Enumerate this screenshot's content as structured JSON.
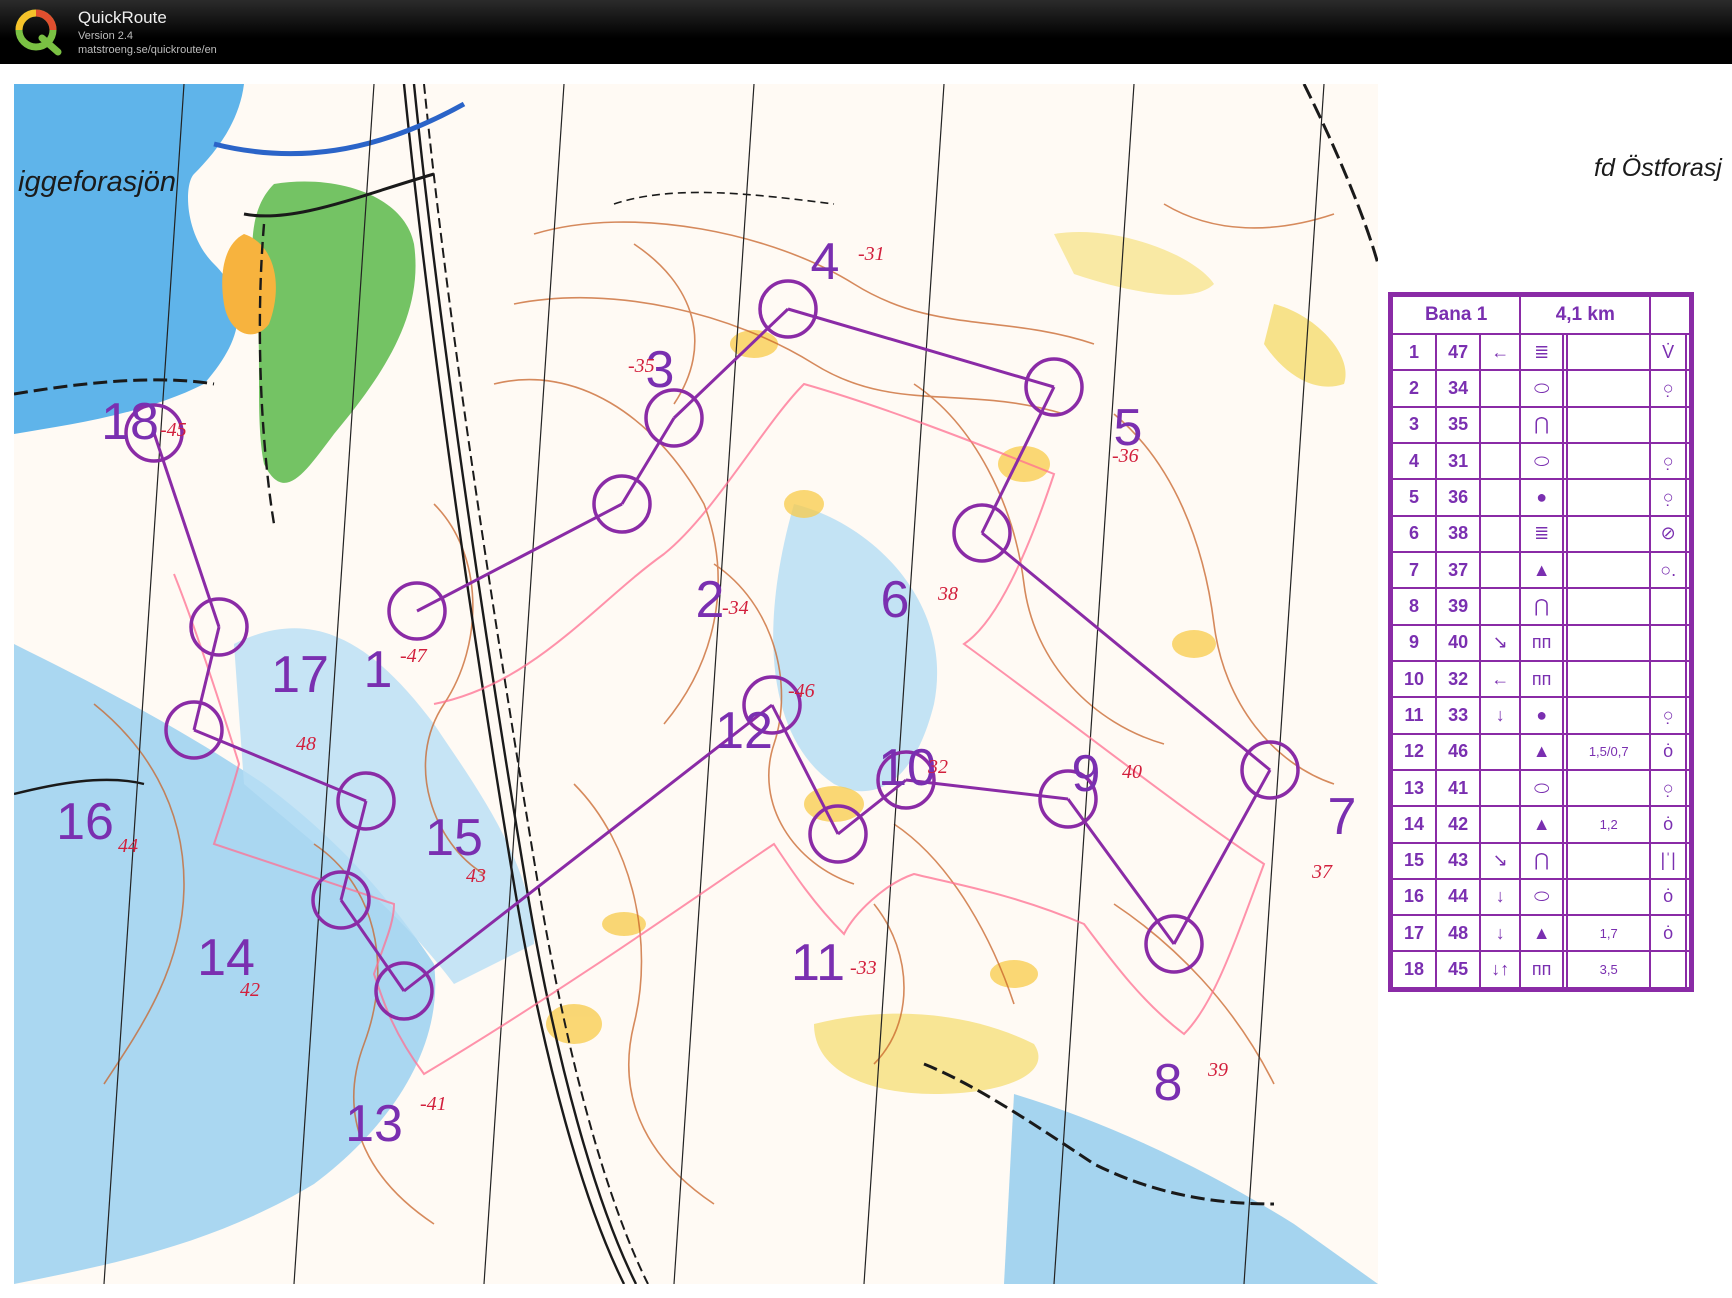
{
  "app": {
    "name": "QuickRoute",
    "version": "Version 2.4",
    "url": "matstroeng.se/quickroute/en",
    "logo_letter": "Q"
  },
  "map": {
    "lake_label": "iggeforasjön",
    "place_label": "fd Östforasj",
    "controls": [
      {
        "num": "1",
        "code_note": "47"
      },
      {
        "num": "2",
        "code_note": "34"
      },
      {
        "num": "3",
        "code_note": "35"
      },
      {
        "num": "4",
        "code_note": "31"
      },
      {
        "num": "5",
        "code_note": "36"
      },
      {
        "num": "6",
        "code_note": "38"
      },
      {
        "num": "7",
        "code_note": "37"
      },
      {
        "num": "8",
        "code_note": "39"
      },
      {
        "num": "9",
        "code_note": "40"
      },
      {
        "num": "10",
        "code_note": "32"
      },
      {
        "num": "11",
        "code_note": "33"
      },
      {
        "num": "12",
        "code_note": "46"
      },
      {
        "num": "13",
        "code_note": "41"
      },
      {
        "num": "14",
        "code_note": "42"
      },
      {
        "num": "15",
        "code_note": "43"
      },
      {
        "num": "16",
        "code_note": "44"
      },
      {
        "num": "17",
        "code_note": "48"
      },
      {
        "num": "18",
        "code_note": "45"
      }
    ],
    "colors": {
      "course": "#8a2ba6",
      "water": "#7fc3ea",
      "open_land": "#f7d25a",
      "forest_green": "#5cb84a",
      "contour": "#c8642a",
      "route_trace": "#ff6f91"
    }
  },
  "description_sheet": {
    "course_name": "Bana 1",
    "length": "4,1 km",
    "rows": [
      {
        "n": "1",
        "code": "47",
        "dir": "←",
        "feature": "≣",
        "dim": "",
        "extra": "V̇"
      },
      {
        "n": "2",
        "code": "34",
        "dir": "",
        "feature": "⬭",
        "dim": "",
        "extra": "○̣"
      },
      {
        "n": "3",
        "code": "35",
        "dir": "",
        "feature": "⋂",
        "dim": "",
        "extra": ""
      },
      {
        "n": "4",
        "code": "31",
        "dir": "",
        "feature": "⬭",
        "dim": "",
        "extra": "○̣"
      },
      {
        "n": "5",
        "code": "36",
        "dir": "",
        "feature": "●",
        "dim": "",
        "extra": "○̣"
      },
      {
        "n": "6",
        "code": "38",
        "dir": "",
        "feature": "≣",
        "dim": "",
        "extra": "⊘"
      },
      {
        "n": "7",
        "code": "37",
        "dir": "",
        "feature": "▲",
        "dim": "",
        "extra": "○."
      },
      {
        "n": "8",
        "code": "39",
        "dir": "",
        "feature": "⋂",
        "dim": "",
        "extra": ""
      },
      {
        "n": "9",
        "code": "40",
        "dir": "↘",
        "feature": "ᴨᴨ",
        "dim": "",
        "extra": ""
      },
      {
        "n": "10",
        "code": "32",
        "dir": "←",
        "feature": "ᴨᴨ",
        "dim": "",
        "extra": ""
      },
      {
        "n": "11",
        "code": "33",
        "dir": "↓",
        "feature": "●",
        "dim": "",
        "extra": "○̣"
      },
      {
        "n": "12",
        "code": "46",
        "dir": "",
        "feature": "▲",
        "dim": "1,5/0,7",
        "extra": "ȯ"
      },
      {
        "n": "13",
        "code": "41",
        "dir": "",
        "feature": "⬭",
        "dim": "",
        "extra": "○̣"
      },
      {
        "n": "14",
        "code": "42",
        "dir": "",
        "feature": "▲",
        "dim": "1,2",
        "extra": "ȯ"
      },
      {
        "n": "15",
        "code": "43",
        "dir": "↘",
        "feature": "⋂",
        "dim": "",
        "extra": "|ˈ|"
      },
      {
        "n": "16",
        "code": "44",
        "dir": "↓",
        "feature": "⬭",
        "dim": "",
        "extra": "ȯ"
      },
      {
        "n": "17",
        "code": "48",
        "dir": "↓",
        "feature": "▲",
        "dim": "1,7",
        "extra": "ȯ"
      },
      {
        "n": "18",
        "code": "45",
        "dir": "↓↑",
        "feature": "ᴨᴨ",
        "dim": "3,5",
        "extra": ""
      }
    ]
  }
}
